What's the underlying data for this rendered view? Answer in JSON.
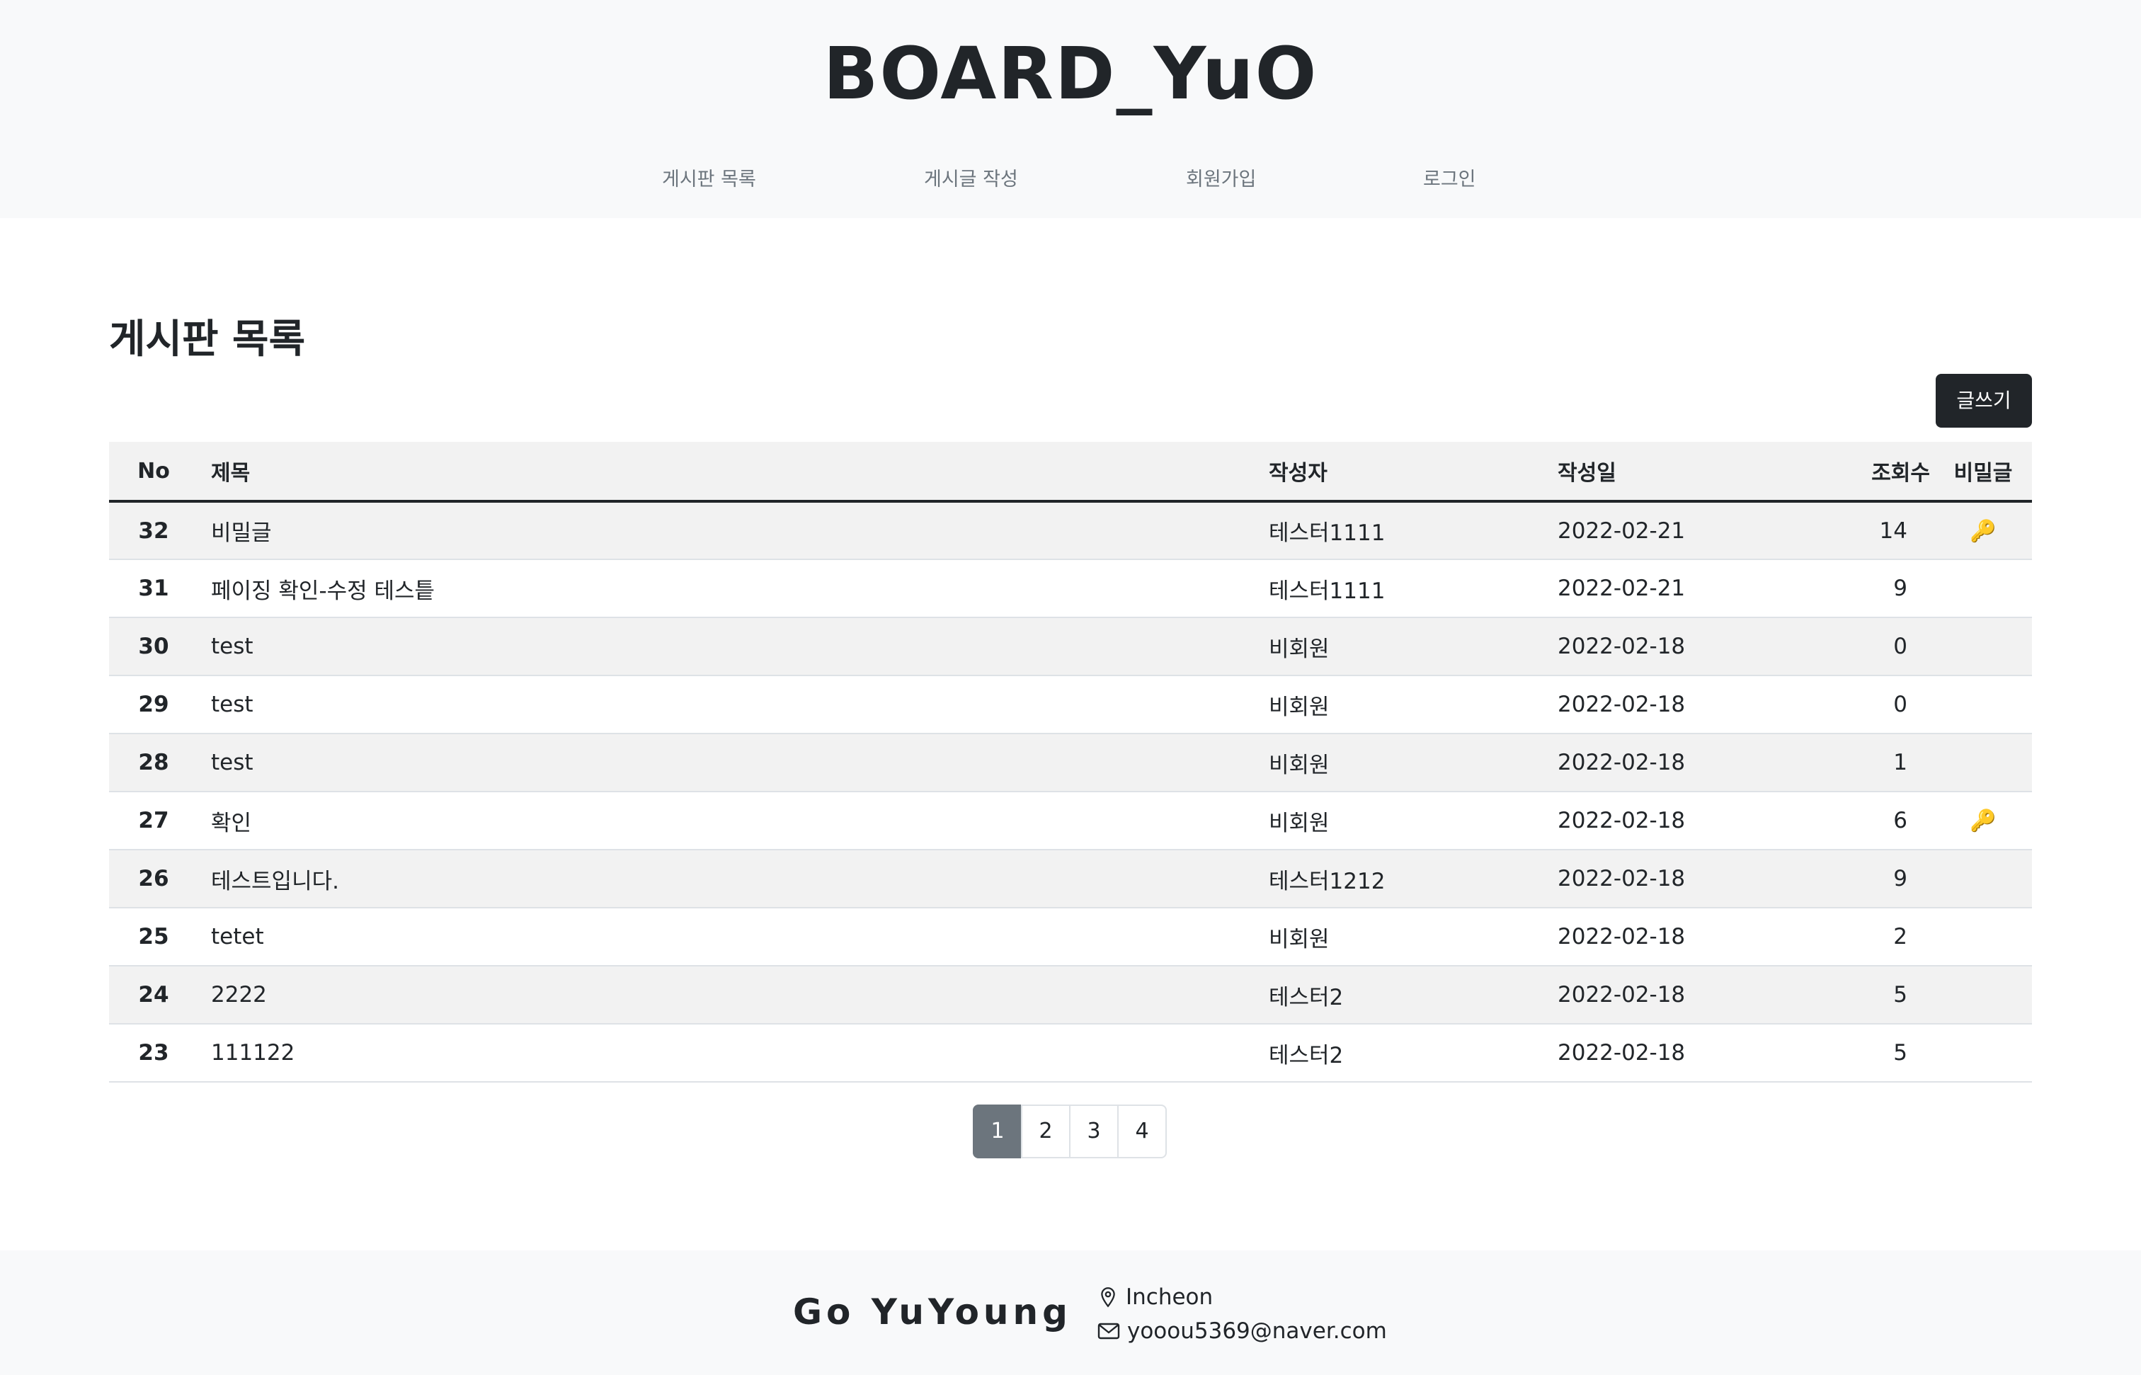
{
  "header": {
    "site_title": "BOARD_YuO",
    "nav": [
      {
        "label": "게시판 목록"
      },
      {
        "label": "게시글 작성"
      },
      {
        "label": "회원가입"
      },
      {
        "label": "로그인"
      }
    ]
  },
  "main": {
    "page_title": "게시판 목록",
    "write_button_label": "글쓰기",
    "table": {
      "headers": {
        "no": "No",
        "title": "제목",
        "author": "작성자",
        "date": "작성일",
        "views": "조회수",
        "secret": "비밀글"
      },
      "rows": [
        {
          "no": "32",
          "title": "비밀글",
          "author": "테스터1111",
          "date": "2022-02-21",
          "views": "14",
          "secret": "🔑",
          "secret_icon": "key-icon"
        },
        {
          "no": "31",
          "title": "페이징 확인-수정 테스틑",
          "author": "테스터1111",
          "date": "2022-02-21",
          "views": "9",
          "secret": ""
        },
        {
          "no": "30",
          "title": "test",
          "author": "비회원",
          "date": "2022-02-18",
          "views": "0",
          "secret": ""
        },
        {
          "no": "29",
          "title": "test",
          "author": "비회원",
          "date": "2022-02-18",
          "views": "0",
          "secret": ""
        },
        {
          "no": "28",
          "title": "test",
          "author": "비회원",
          "date": "2022-02-18",
          "views": "1",
          "secret": ""
        },
        {
          "no": "27",
          "title": "확인",
          "author": "비회원",
          "date": "2022-02-18",
          "views": "6",
          "secret": "🔑",
          "secret_icon": "key-icon"
        },
        {
          "no": "26",
          "title": "테스트입니다.",
          "author": "테스터1212",
          "date": "2022-02-18",
          "views": "9",
          "secret": ""
        },
        {
          "no": "25",
          "title": "tetet",
          "author": "비회원",
          "date": "2022-02-18",
          "views": "2",
          "secret": ""
        },
        {
          "no": "24",
          "title": "2222",
          "author": "테스터2",
          "date": "2022-02-18",
          "views": "5",
          "secret": ""
        },
        {
          "no": "23",
          "title": "111122",
          "author": "테스터2",
          "date": "2022-02-18",
          "views": "5",
          "secret": ""
        }
      ]
    },
    "pagination": {
      "pages": [
        "1",
        "2",
        "3",
        "4"
      ],
      "active": "1"
    }
  },
  "footer": {
    "name": "Go YuYoung",
    "location": "Incheon",
    "location_icon": "map-pin-icon",
    "email": "yooou5369@naver.com",
    "email_icon": "envelope-icon"
  },
  "colors": {
    "header_bg": "#f8f9fa",
    "button_bg": "#212529",
    "active_page_bg": "#6c757d",
    "striped_row_bg": "#f2f2f2"
  }
}
